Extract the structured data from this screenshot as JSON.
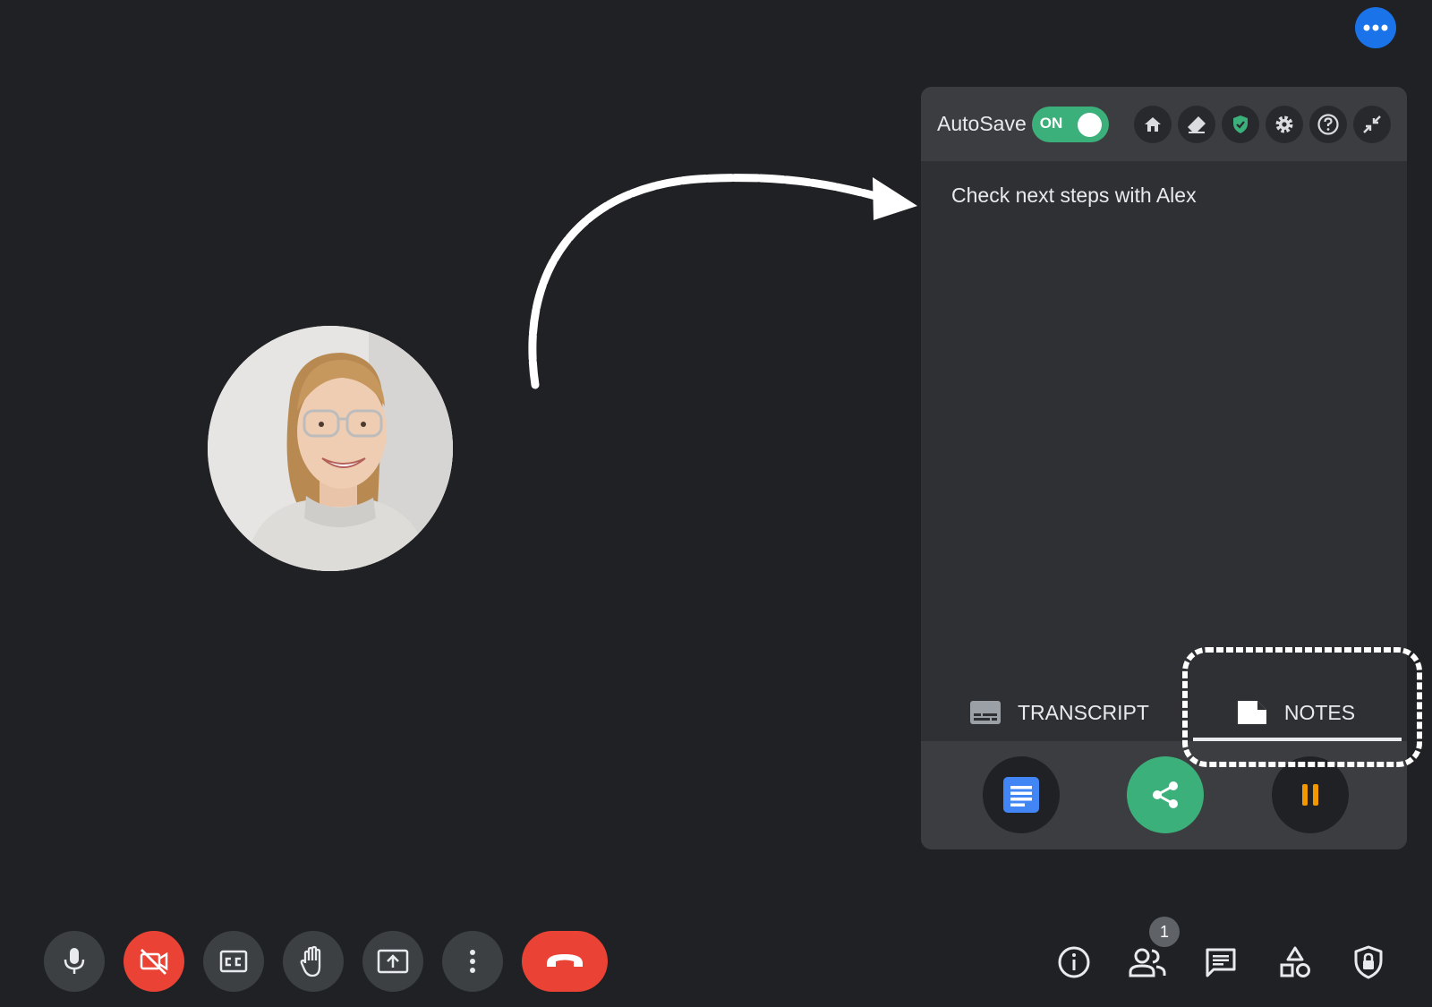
{
  "top": {
    "more_icon": "more-horiz-icon"
  },
  "participant": {
    "avatar_label": ""
  },
  "panel": {
    "autosave_label": "AutoSave",
    "toggle_text": "ON",
    "header_icons": [
      "home-icon",
      "eraser-icon",
      "shield-check-icon",
      "gear-icon",
      "help-icon",
      "collapse-icon"
    ],
    "note_text": "Check next steps with Alex",
    "tabs": [
      {
        "label": "TRANSCRIPT",
        "icon": "subtitles-icon",
        "active": false
      },
      {
        "label": "NOTES",
        "icon": "note-icon",
        "active": true
      }
    ],
    "actions": [
      "google-docs-icon",
      "share-icon",
      "pause-icon"
    ]
  },
  "controls": {
    "left": [
      "microphone-icon",
      "camera-off-icon",
      "captions-icon",
      "raise-hand-icon",
      "present-screen-icon",
      "more-vert-icon",
      "end-call-icon"
    ],
    "right": [
      "info-icon",
      "people-icon",
      "chat-icon",
      "activities-icon",
      "host-controls-icon"
    ],
    "participant_count": "1"
  },
  "colors": {
    "background": "#202124",
    "accent_blue": "#1a73e8",
    "toggle_green": "#3cb07a",
    "danger_red": "#ea4335",
    "pause_orange": "#f29900"
  }
}
